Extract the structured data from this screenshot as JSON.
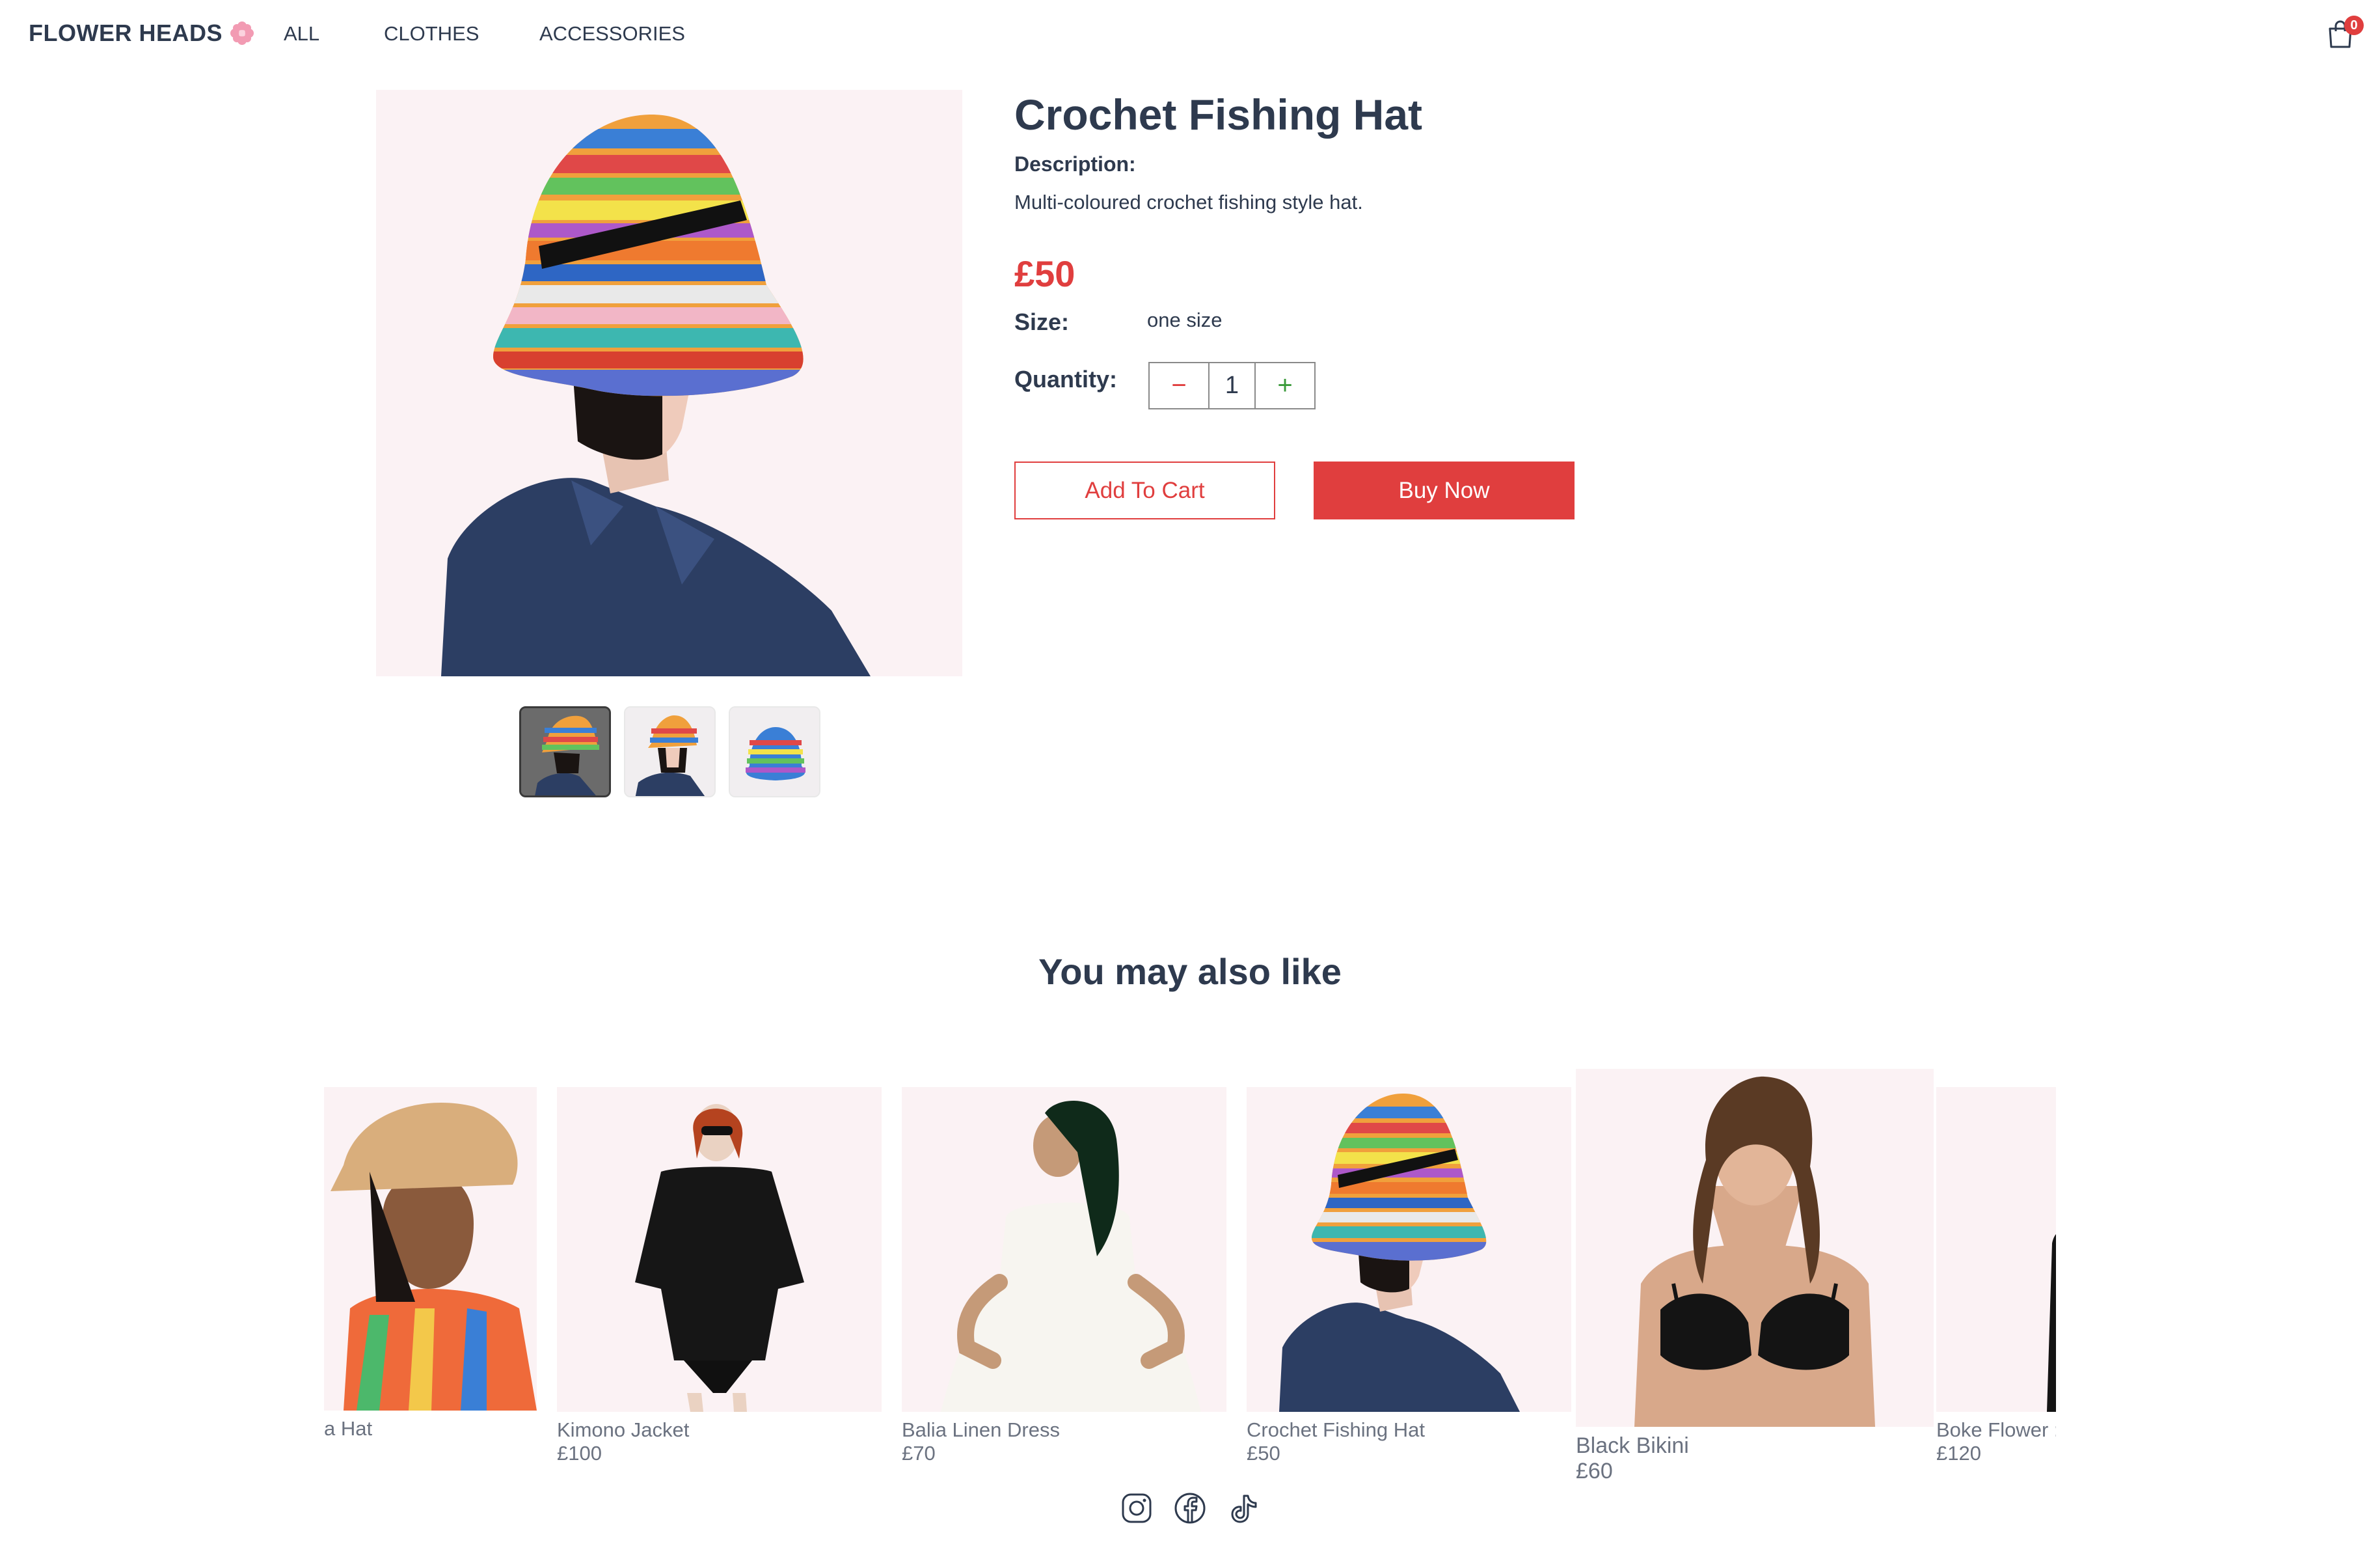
{
  "brand": {
    "name": "FLOWER HEADS",
    "accent": "#e03e3e",
    "flower_color": "#f29bb3"
  },
  "nav": {
    "all": "ALL",
    "clothes": "CLOTHES",
    "accessories": "ACCESSORIES"
  },
  "cart": {
    "count": "0"
  },
  "product": {
    "title": "Crochet Fishing Hat",
    "description_label": "Description:",
    "description": "Multi-coloured crochet fishing style hat.",
    "price": "£50",
    "size_label": "Size:",
    "size_value": "one size",
    "quantity_label": "Quantity:",
    "quantity": "1",
    "minus": "−",
    "plus": "+",
    "add_to_cart": "Add To Cart",
    "buy_now": "Buy Now"
  },
  "recommendations": {
    "title": "You may also like",
    "items": [
      {
        "name": "a Hat",
        "price": ""
      },
      {
        "name": "Kimono Jacket",
        "price": "£100"
      },
      {
        "name": "Balia Linen Dress",
        "price": "£70"
      },
      {
        "name": "Crochet Fishing Hat",
        "price": "£50"
      },
      {
        "name": "Black Bikini",
        "price": "£60"
      },
      {
        "name": "Boke Flower :",
        "price": "£120"
      }
    ]
  },
  "social": [
    "instagram-icon",
    "facebook-icon",
    "tiktok-icon"
  ]
}
